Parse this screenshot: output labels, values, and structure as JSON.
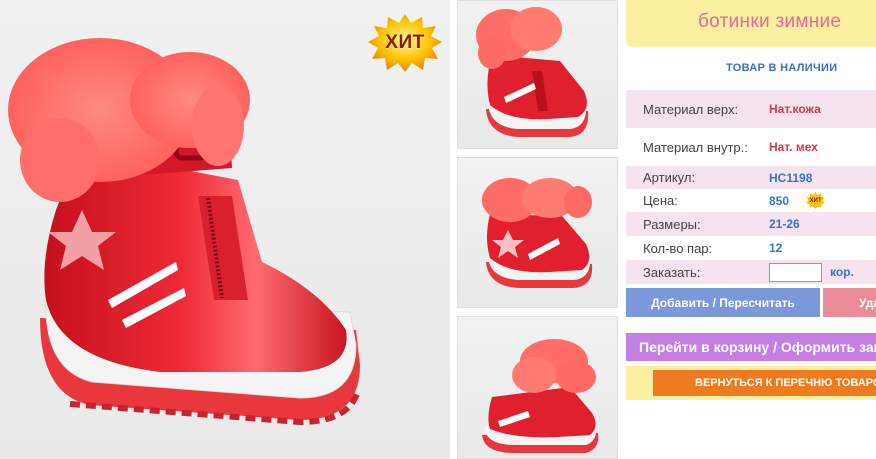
{
  "badge": {
    "hit_label": "ХИТ"
  },
  "product": {
    "title": "ботинки зимние",
    "stock_status": "ТОВАР В НАЛИЧИИ",
    "specs": [
      {
        "label": "Материал верх:",
        "value": "Нат.кожа"
      },
      {
        "label": "Материал внутр.:",
        "value": "Нат. мех"
      },
      {
        "label": "Артикул:",
        "value": "HC1198"
      },
      {
        "label": "Цена:",
        "value": "850"
      },
      {
        "label": "Размеры:",
        "value": "21-26"
      },
      {
        "label": "Кол-во пар:",
        "value": "12"
      },
      {
        "label": "Заказать:",
        "value": ""
      }
    ],
    "order_unit": "кор.",
    "price_badge": "ХИТ"
  },
  "actions": {
    "add_label": "Добавить / Пересчитать",
    "delete_label": "Удалить",
    "cart_label": "Перейти в корзину / Оформить заказ",
    "back_label": "ВЕРНУТЬСЯ К ПЕРЕЧНЮ ТОВАРОВ"
  },
  "colors": {
    "title_bg": "#faf0a0",
    "title_text": "#e86a9a",
    "accent_blue": "#3a72c4",
    "row_pink": "#f6e3f0",
    "boot_red": "#e0202e",
    "fur": "#ff6a64",
    "back_orange": "#f07a20"
  },
  "icons": {
    "hit_badge": "starburst-badge-icon",
    "thumb_1": "boot-front-thumbnail",
    "thumb_2": "boot-star-thumbnail",
    "thumb_3": "boot-side-thumbnail"
  }
}
